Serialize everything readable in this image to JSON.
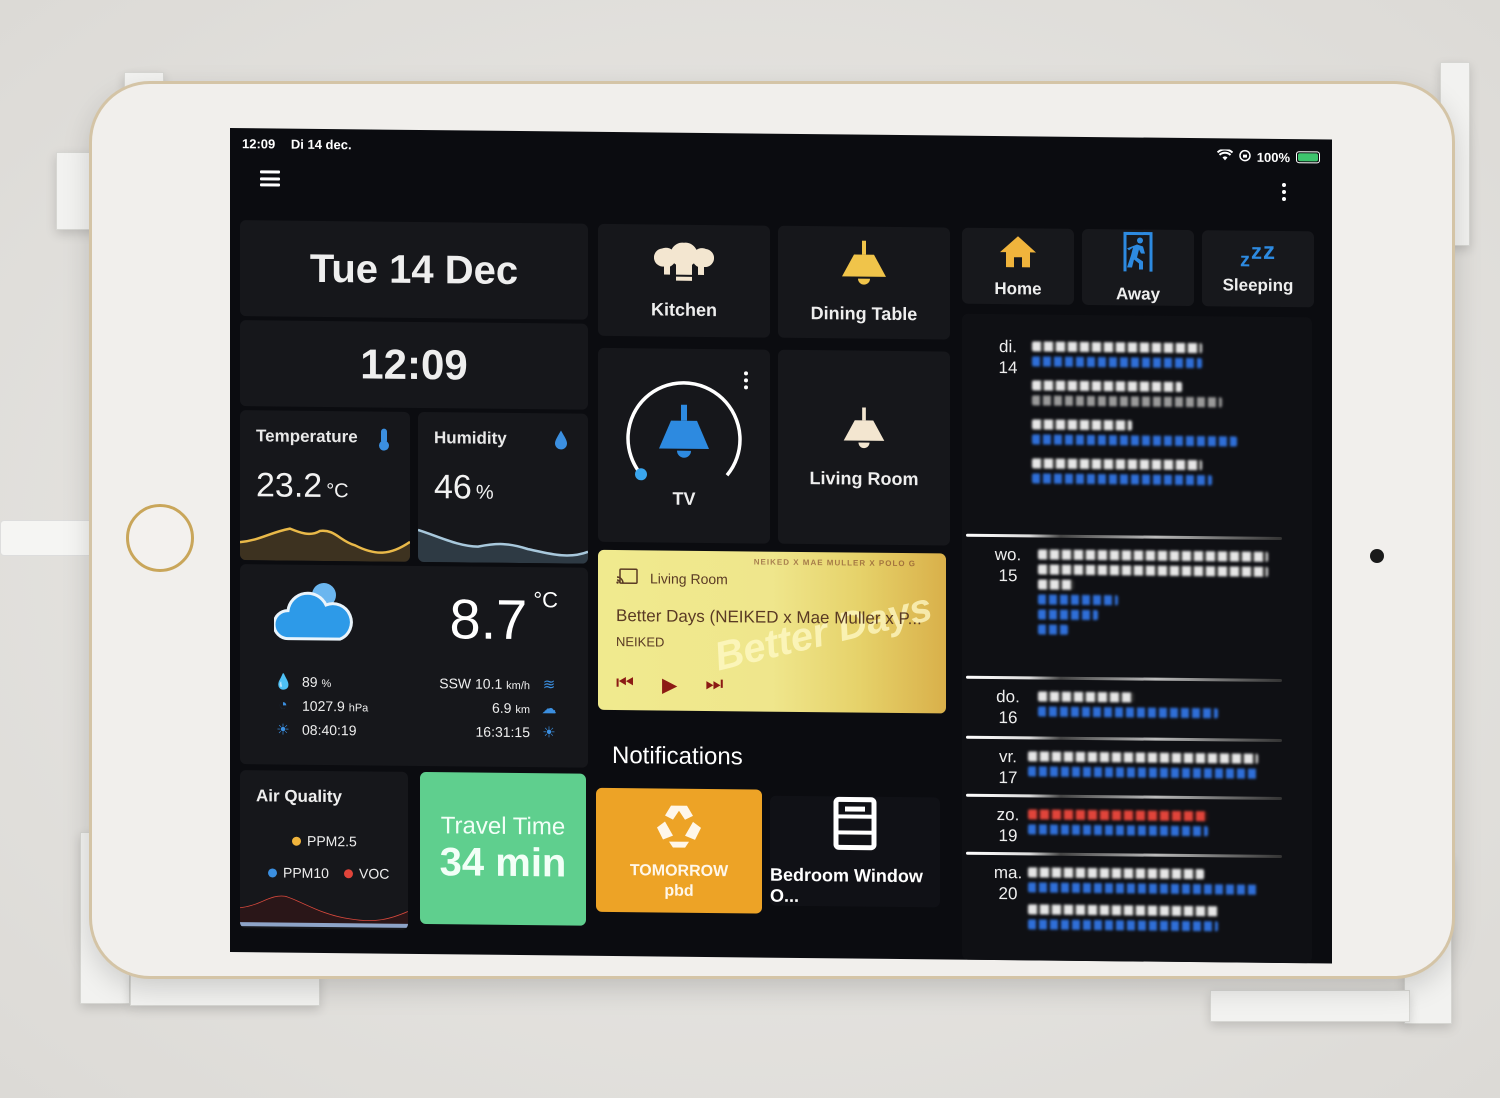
{
  "status_bar": {
    "time": "12:09",
    "date": "Di 14 dec.",
    "battery": "100%",
    "wifi_icon": "wifi-icon",
    "orientation_lock_icon": "orientation-lock-icon",
    "battery_icon": "battery-charging-icon"
  },
  "header": {
    "menu_icon": "hamburger-menu-icon",
    "more_icon": "more-vertical-icon"
  },
  "clock": {
    "date": "Tue 14 Dec",
    "time": "12:09"
  },
  "sensors": {
    "temperature": {
      "label": "Temperature",
      "value": "23.2",
      "unit": "°C",
      "icon": "thermometer-icon",
      "color": "#e9b949"
    },
    "humidity": {
      "label": "Humidity",
      "value": "46",
      "unit": "%",
      "icon": "water-percent-icon",
      "color": "#a8c8dc"
    }
  },
  "weather": {
    "condition_icon": "cloudy-icon",
    "temperature": "8.7",
    "temperature_unit": "°C",
    "humidity": {
      "value": "89",
      "unit": "%"
    },
    "pressure": {
      "value": "1027.9",
      "unit": "hPa"
    },
    "sunrise": "08:40:19",
    "wind": {
      "value": "SSW 10.1",
      "unit": "km/h"
    },
    "visibility": {
      "value": "6.9",
      "unit": "km"
    },
    "sunset": "16:31:15"
  },
  "air_quality": {
    "label": "Air Quality",
    "icon": "thermometer-icon",
    "legend": [
      {
        "name": "PPM2.5",
        "color": "#f0b43c"
      },
      {
        "name": "PPM10",
        "color": "#3b8fe0"
      },
      {
        "name": "VOC",
        "color": "#e0443a"
      }
    ]
  },
  "travel_time": {
    "label": "Travel Time",
    "value": "34 min",
    "color": "#5fcf8e"
  },
  "lights": [
    {
      "name": "Kitchen",
      "icon": "ceiling-lights-icon",
      "color": "#f3e6d0"
    },
    {
      "name": "Dining Table",
      "icon": "pendant-lamp-icon",
      "color": "#f0c44a"
    },
    {
      "name": "TV",
      "icon": "pendant-lamp-icon",
      "color": "#2d8ae0",
      "brightness_pct": 1
    },
    {
      "name": "Living Room",
      "icon": "pendant-lamp-icon",
      "color": "#f3e6d0"
    }
  ],
  "media_player": {
    "source": "Living Room",
    "title": "Better Days (NEIKED x Mae Muller x P...",
    "artist": "NEIKED",
    "art_banner": "NEIKED X MAE MULLER X POLO G",
    "art_text": "Better Days",
    "controls": {
      "prev": "previous-track-icon",
      "play": "play-icon",
      "next": "next-track-icon"
    }
  },
  "notifications": {
    "title": "Notifications",
    "items": [
      {
        "line1": "TOMORROW",
        "line2": "pbd",
        "icon": "recycle-icon",
        "color": "#eda326"
      },
      {
        "label": "Bedroom Window O...",
        "icon": "window-open-icon"
      }
    ]
  },
  "modes": [
    {
      "label": "Home",
      "icon": "home-icon",
      "color": "#f0b43c"
    },
    {
      "label": "Away",
      "icon": "exit-run-icon",
      "color": "#2d8ae0"
    },
    {
      "label": "Sleeping",
      "icon": "sleep-zzz-icon",
      "color": "#2d8ae0"
    }
  ],
  "calendar": {
    "days": [
      {
        "weekday": "di.",
        "day": "14"
      },
      {
        "weekday": "wo.",
        "day": "15"
      },
      {
        "weekday": "do.",
        "day": "16"
      },
      {
        "weekday": "vr.",
        "day": "17"
      },
      {
        "weekday": "zo.",
        "day": "19"
      },
      {
        "weekday": "ma.",
        "day": "20"
      }
    ]
  }
}
